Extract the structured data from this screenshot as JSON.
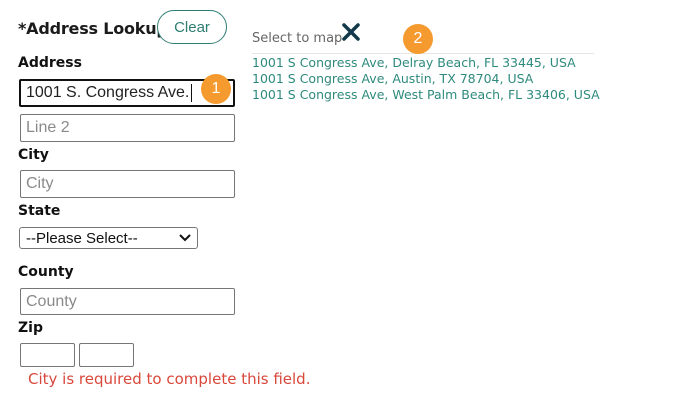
{
  "form": {
    "title": "*Address Lookup",
    "clear_label": "Clear",
    "address_label": "Address",
    "address_value": "1001 S. Congress Ave.",
    "line2_placeholder": "Line 2",
    "city_label": "City",
    "city_placeholder": "City",
    "state_label": "State",
    "state_selected": "--Please Select--",
    "county_label": "County",
    "county_placeholder": "County",
    "zip_label": "Zip",
    "zip_value": "",
    "zip_ext_value": "",
    "error_text": "City is required to complete this field."
  },
  "suggestions": {
    "header": "Select to map",
    "close_icon": "close-icon",
    "items": [
      "1001 S Congress Ave, Delray Beach, FL 33445, USA",
      "1001 S Congress Ave, Austin, TX 78704, USA",
      "1001 S Congress Ave, West Palm Beach, FL 33406, USA"
    ]
  },
  "badges": [
    "1",
    "2"
  ],
  "colors": {
    "accent": "#2e7d72",
    "badge": "#f59a2f",
    "error": "#d9483b",
    "close": "#12394a"
  }
}
